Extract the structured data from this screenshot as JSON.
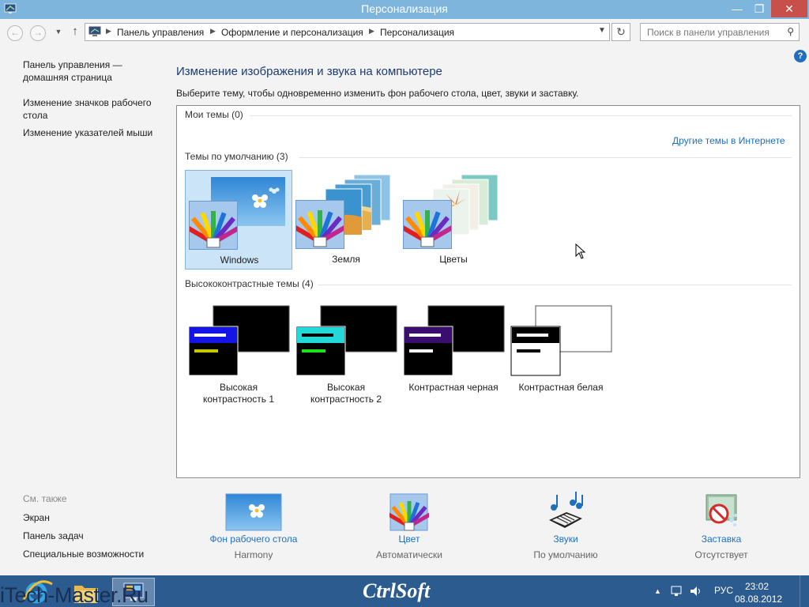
{
  "window": {
    "title": "Персонализация",
    "min_glyph": "—",
    "max_glyph": "❐",
    "close_glyph": "✕"
  },
  "address": {
    "crumbs": [
      "Панель управления",
      "Оформление и персонализация",
      "Персонализация"
    ],
    "search_placeholder": "Поиск в панели управления"
  },
  "left": {
    "home_link": "Панель управления — домашняя страница",
    "icons_link": "Изменение значков рабочего стола",
    "pointers_link": "Изменение указателей мыши",
    "see_also": "См. также",
    "see_also_items": [
      "Экран",
      "Панель задач",
      "Специальные возможности"
    ]
  },
  "main": {
    "heading": "Изменение изображения и звука на компьютере",
    "subtitle": "Выберите тему, чтобы одновременно изменить фон рабочего стола, цвет, звуки и заставку.",
    "my_themes": "Мои темы (0)",
    "more_themes": "Другие темы в Интернете",
    "default_themes": "Темы по умолчанию (3)",
    "default_items": [
      "Windows",
      "Земля",
      "Цветы"
    ],
    "hc_themes": "Высококонтрастные темы (4)",
    "hc_items": [
      {
        "line1": "Высокая",
        "line2": "контрастность 1"
      },
      {
        "line1": "Высокая",
        "line2": "контрастность 2"
      },
      {
        "line1": "Контрастная черная",
        "line2": ""
      },
      {
        "line1": "Контрастная белая",
        "line2": ""
      }
    ]
  },
  "bottom": [
    {
      "name": "Фон рабочего стола",
      "value": "Harmony"
    },
    {
      "name": "Цвет",
      "value": "Автоматически"
    },
    {
      "name": "Звуки",
      "value": "По умолчанию"
    },
    {
      "name": "Заставка",
      "value": "Отсутствует"
    }
  ],
  "taskbar": {
    "watermark": "iTech-Master.Ru",
    "brand": "CtrlSoft",
    "lang": "РУС",
    "time": "23:02",
    "date": "08.08.2012"
  }
}
